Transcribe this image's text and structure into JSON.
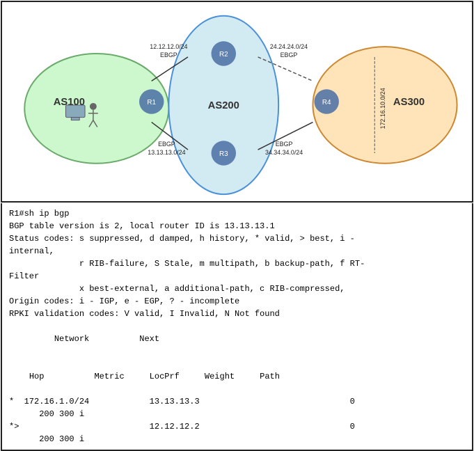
{
  "diagram": {
    "as100_label": "AS100",
    "as200_label": "AS200",
    "as300_label": "AS300",
    "link_labels": {
      "top_left": "12.12.12.0/24",
      "top_left_proto": "EBGP",
      "top_right": "24.24.24.0/24",
      "top_right_proto": "EBGP",
      "bottom_left": "EBGP",
      "bottom_left_net": "13.13.13.0/24",
      "bottom_right": "EBGP",
      "bottom_right_net": "34.34.34.0/24",
      "vertical_net": "172.16.10.0/24"
    }
  },
  "terminal": {
    "prompt": "R1#sh ip bgp",
    "line1": "BGP table version is 2, local router ID is 13.13.13.1",
    "line2": "Status codes: s suppressed, d damped, h history, * valid, > best, i -",
    "line3": "internal,",
    "line4": "              r RIB-failure, S Stale, m multipath, b backup-path, f RT-",
    "line5": "Filter",
    "line6": "              x best-external, a additional-path, c RIB-compressed,",
    "line7": "Origin codes: i - IGP, e - EGP, ? - incomplete",
    "line8": "RPKI validation codes: V valid, I Invalid, N Not found",
    "header": {
      "network": "Network",
      "next": "Next",
      "hop": "Hop",
      "metric": "Metric",
      "locprf": "LocPrf",
      "weight": "Weight",
      "path": "Path"
    },
    "rows": [
      {
        "marker": "*",
        "network": "172.16.1.0/24",
        "nexthop": "13.13.13.3",
        "metric": "",
        "locprf": "",
        "weight": "",
        "path_val": "0"
      },
      {
        "marker": "",
        "network": "    200 300 i",
        "nexthop": "",
        "metric": "",
        "locprf": "",
        "weight": "",
        "path_val": ""
      },
      {
        "marker": "*>",
        "network": "",
        "nexthop": "12.12.12.2",
        "metric": "",
        "locprf": "",
        "weight": "",
        "path_val": "0"
      },
      {
        "marker": "",
        "network": "    200 300 i",
        "nexthop": "",
        "metric": "",
        "locprf": "",
        "weight": "",
        "path_val": ""
      }
    ]
  }
}
